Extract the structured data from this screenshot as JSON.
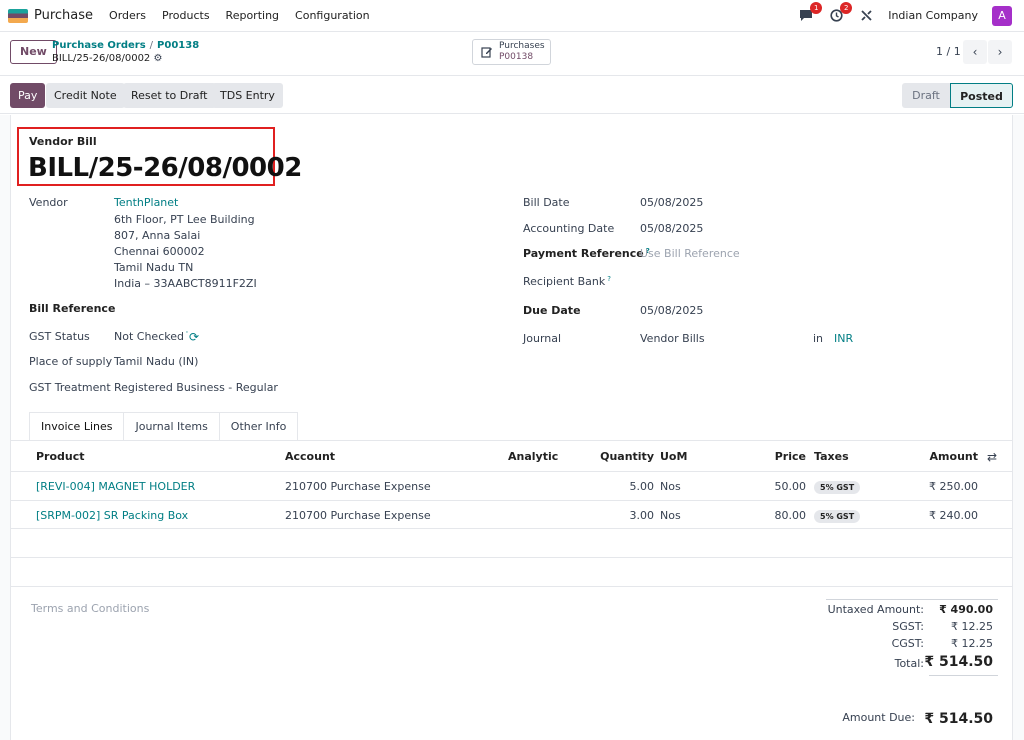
{
  "topbar": {
    "app_name": "Purchase",
    "menu": [
      "Orders",
      "Products",
      "Reporting",
      "Configuration"
    ],
    "messages_count": "1",
    "activities_count": "2",
    "company": "Indian Company",
    "avatar_letter": "A"
  },
  "control": {
    "new_label": "New",
    "breadcrumb_parent": "Purchase Orders",
    "breadcrumb_current": "P00138",
    "record_name": "BILL/25-26/08/0002",
    "smart_button_title": "Purchases",
    "smart_button_value": "P00138",
    "pager": "1 / 1"
  },
  "actions": {
    "pay": "Pay",
    "credit_note": "Credit Note",
    "reset_to_draft": "Reset to Draft",
    "tds_entry": "TDS Entry"
  },
  "status": {
    "draft": "Draft",
    "posted": "Posted"
  },
  "form": {
    "type_label": "Vendor Bill",
    "name": "BILL/25-26/08/0002",
    "vendor_label": "Vendor",
    "vendor_name": "TenthPlanet",
    "vendor_address": [
      "6th Floor, PT Lee Building",
      "807, Anna Salai",
      "Chennai 600002",
      "Tamil Nadu TN",
      "India – 33AABCT8911F2ZI"
    ],
    "bill_reference_label": "Bill Reference",
    "gst_status_label": "GST Status",
    "gst_status_value": "Not Checked",
    "place_of_supply_label": "Place of supply",
    "place_of_supply_value": "Tamil Nadu (IN)",
    "gst_treatment_label": "GST Treatment",
    "gst_treatment_value": "Registered Business - Regular",
    "bill_date_label": "Bill Date",
    "bill_date_value": "05/08/2025",
    "accounting_date_label": "Accounting Date",
    "accounting_date_value": "05/08/2025",
    "payment_reference_label": "Payment Reference",
    "payment_reference_placeholder": "Use Bill Reference",
    "recipient_bank_label": "Recipient Bank",
    "due_date_label": "Due Date",
    "due_date_value": "05/08/2025",
    "journal_label": "Journal",
    "journal_value": "Vendor Bills",
    "currency_in": "in",
    "currency_value": "INR",
    "help_mark": "?"
  },
  "tabs": [
    "Invoice Lines",
    "Journal Items",
    "Other Info"
  ],
  "lines": {
    "headers": {
      "product": "Product",
      "account": "Account",
      "analytic": "Analytic",
      "quantity": "Quantity",
      "uom": "UoM",
      "price": "Price",
      "taxes": "Taxes",
      "amount": "Amount"
    },
    "rows": [
      {
        "product": "[REVI-004] MAGNET HOLDER",
        "account": "210700 Purchase Expense",
        "quantity": "5.00",
        "uom": "Nos",
        "price": "50.00",
        "tax": "5% GST",
        "amount": "₹ 250.00"
      },
      {
        "product": "[SRPM-002] SR Packing Box",
        "account": "210700 Purchase Expense",
        "quantity": "3.00",
        "uom": "Nos",
        "price": "80.00",
        "tax": "5% GST",
        "amount": "₹ 240.00"
      }
    ]
  },
  "footer": {
    "terms_placeholder": "Terms and Conditions",
    "untaxed_label": "Untaxed Amount:",
    "untaxed_value": "₹ 490.00",
    "sgst_label": "SGST:",
    "sgst_value": "₹ 12.25",
    "cgst_label": "CGST:",
    "cgst_value": "₹ 12.25",
    "total_label": "Total:",
    "total_value": "₹ 514.50",
    "amount_due_label": "Amount Due:",
    "amount_due_value": "₹ 514.50"
  },
  "colors": {
    "brand": "#714b67",
    "link": "#017e84",
    "highlight": "#e02020"
  }
}
